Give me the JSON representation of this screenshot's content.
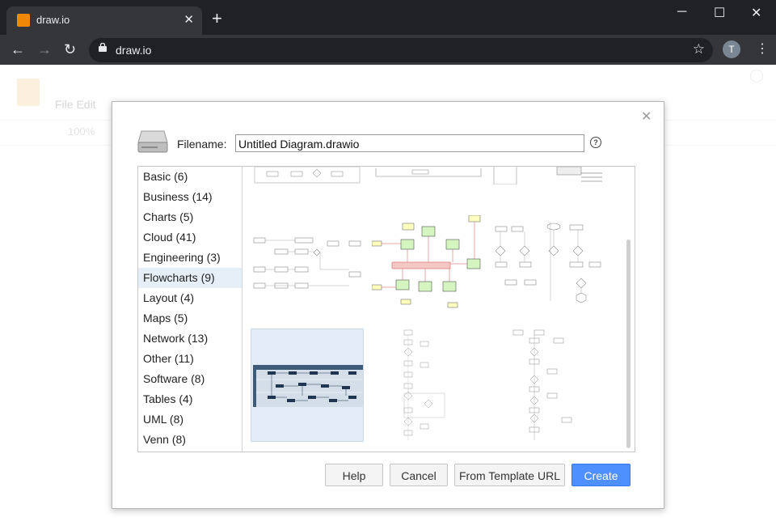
{
  "browser": {
    "tab_title": "draw.io",
    "url": "draw.io",
    "profile_initial": "T"
  },
  "app": {
    "menu": "File  Edit",
    "zoom": "100%"
  },
  "dialog": {
    "filename_label": "Filename:",
    "filename_value": "Untitled Diagram.drawio",
    "categories": [
      {
        "label": "Basic (6)"
      },
      {
        "label": "Business (14)"
      },
      {
        "label": "Charts (5)"
      },
      {
        "label": "Cloud (41)"
      },
      {
        "label": "Engineering (3)"
      },
      {
        "label": "Flowcharts (9)",
        "selected": true
      },
      {
        "label": "Layout (4)"
      },
      {
        "label": "Maps (5)"
      },
      {
        "label": "Network (13)"
      },
      {
        "label": "Other (11)"
      },
      {
        "label": "Software (8)"
      },
      {
        "label": "Tables (4)"
      },
      {
        "label": "UML (8)"
      },
      {
        "label": "Venn (8)"
      }
    ],
    "buttons": {
      "help": "Help",
      "cancel": "Cancel",
      "template_url": "From Template URL",
      "create": "Create"
    }
  },
  "colors": {
    "accent": "#4d90fe",
    "selected_bg": "#e6eef8",
    "brand": "#f08705"
  }
}
